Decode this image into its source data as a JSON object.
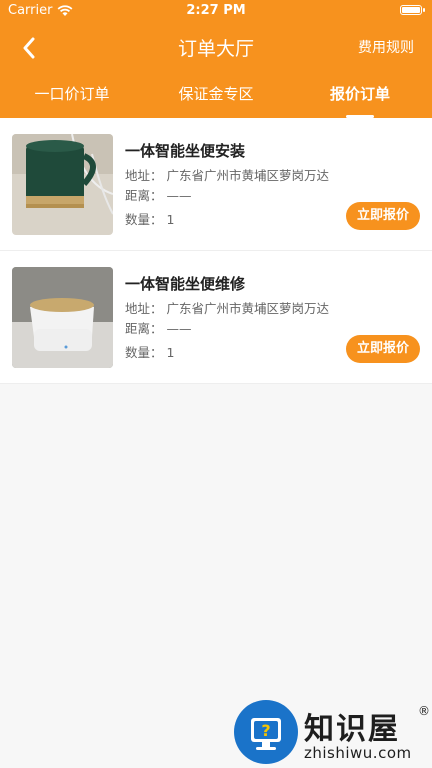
{
  "status_bar": {
    "carrier": "Carrier",
    "time": "2:27 PM"
  },
  "nav": {
    "title": "订单大厅",
    "right_link": "费用规则",
    "back_icon": "chevron-left-icon"
  },
  "tabs": [
    {
      "label": "一口价订单",
      "active": false
    },
    {
      "label": "保证金专区",
      "active": false
    },
    {
      "label": "报价订单",
      "active": true
    }
  ],
  "orders": [
    {
      "title": "一体智能坐便安装",
      "address_label": "地址：",
      "address": "广东省广州市黄埔区萝岗万达",
      "distance_label": "距离：",
      "distance": "——",
      "quantity_label": "数量：",
      "quantity": "1",
      "button": "立即报价"
    },
    {
      "title": "一体智能坐便维修",
      "address_label": "地址：",
      "address": "广东省广州市黄埔区萝岗万达",
      "distance_label": "距离：",
      "distance": "——",
      "quantity_label": "数量：",
      "quantity": "1",
      "button": "立即报价"
    }
  ],
  "watermark": {
    "name": "知识屋",
    "reg": "®",
    "domain": "zhishiwu.com"
  },
  "colors": {
    "accent": "#f7921e",
    "background": "#f7f7f7"
  }
}
